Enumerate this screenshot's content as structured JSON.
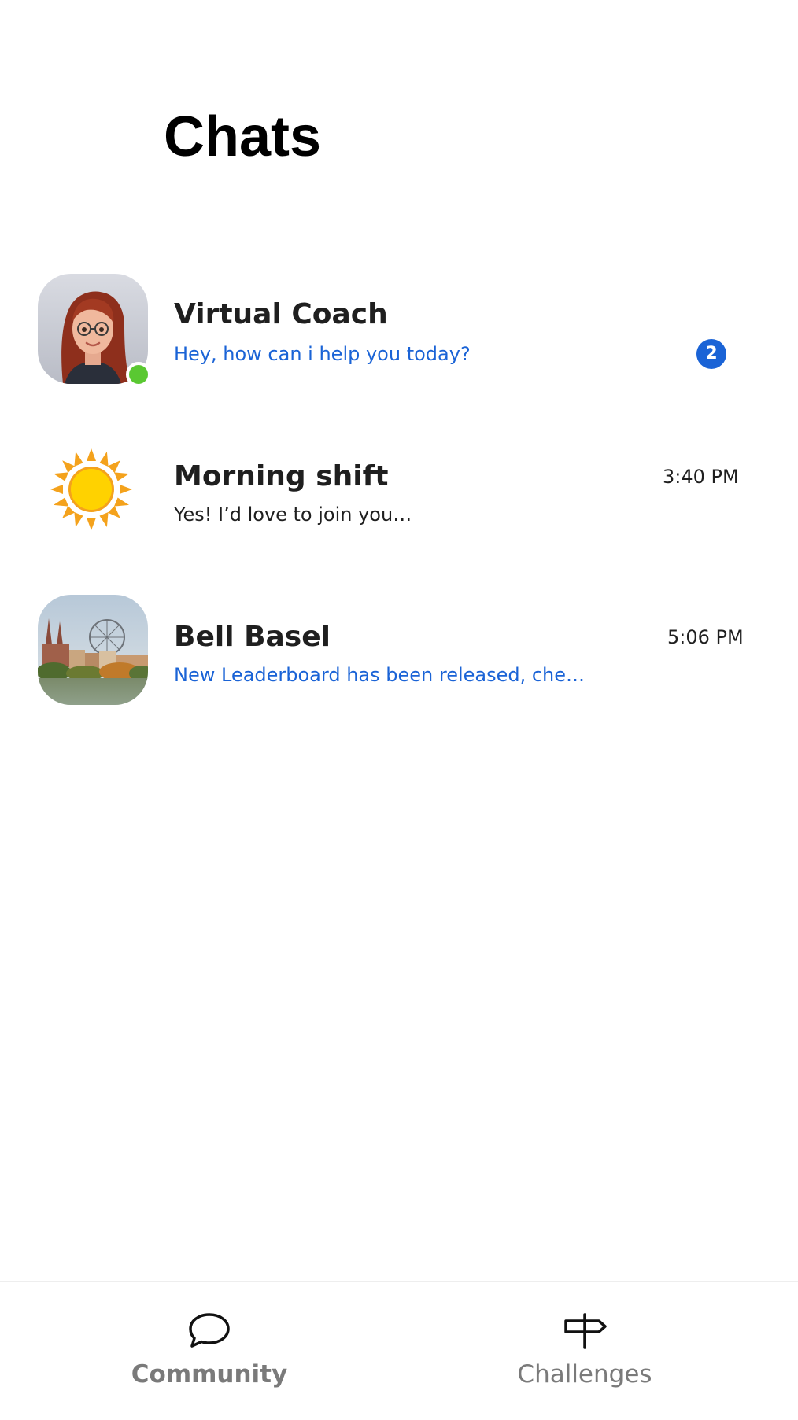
{
  "header": {
    "title": "Chats"
  },
  "chats": [
    {
      "name": "Virtual Coach",
      "preview": "Hey, how can i help you today?",
      "time": "",
      "unread_count": "2",
      "online": true,
      "avatar": "virtual-coach-avatar",
      "preview_color": "#1a63d6"
    },
    {
      "name": "Morning shift",
      "preview": "Yes! I’d love to join you…",
      "time": "3:40 PM",
      "unread_count": "",
      "online": false,
      "avatar": "sun-icon",
      "preview_color": "#1f1f1f"
    },
    {
      "name": "Bell Basel",
      "preview": "New Leaderboard has been released, che…",
      "time": "5:06 PM",
      "unread_count": "",
      "online": false,
      "avatar": "basel-city-photo",
      "preview_color": "#1a63d6"
    }
  ],
  "tab_bar": {
    "tabs": [
      {
        "label": "Community",
        "icon": "chat-bubble-icon",
        "active": true
      },
      {
        "label": "Challenges",
        "icon": "signpost-icon",
        "active": false
      }
    ]
  },
  "colors": {
    "accent": "#1a63d6",
    "online": "#5ac832",
    "tab_label": "#7a7a7a"
  }
}
